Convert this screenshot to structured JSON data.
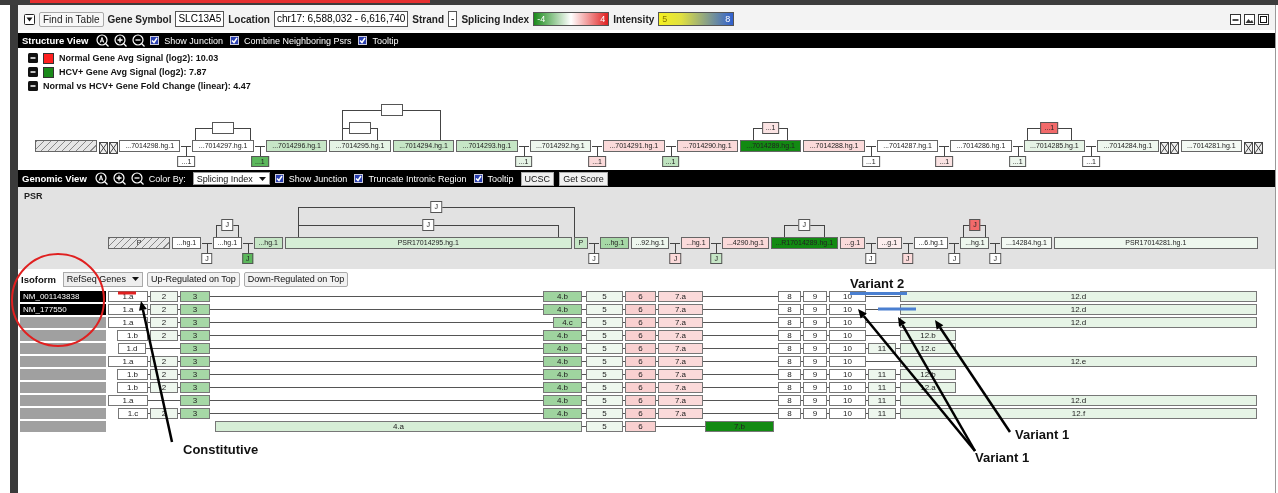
{
  "toolbar": {
    "find_button": "Find in Table",
    "fields": [
      {
        "label": "Gene Symbol",
        "value": "SLC13A5"
      },
      {
        "label": "Location",
        "value": "chr17: 6,588,032 - 6,616,740"
      },
      {
        "label": "Strand",
        "value": "-"
      }
    ],
    "scales": [
      {
        "label": "Splicing Index",
        "kind": "splicing",
        "min": "-4",
        "max": "4"
      },
      {
        "label": "Intensity",
        "kind": "intensity",
        "min": "5",
        "max": "8"
      }
    ]
  },
  "structure_view": {
    "title": "Structure View",
    "options": [
      {
        "label": "Show Junction",
        "checked": true
      },
      {
        "label": "Combine Neighboring Psrs",
        "checked": true
      },
      {
        "label": "Tooltip",
        "checked": true
      }
    ],
    "legend": [
      {
        "text": "Normal Gene Avg Signal (log2): 10.03",
        "color": "#ff2020"
      },
      {
        "text": "HCV+ Gene Avg Signal (log2): 7.87",
        "color": "#1a8a1a"
      },
      {
        "text": "Normal vs HCV+ Gene Fold Change (linear): 4.47"
      }
    ],
    "nodes": [
      {
        "kind": "hatch"
      },
      {
        "kind": "x"
      },
      {
        "kind": "x"
      },
      {
        "kind": "exon",
        "label": "...7014298.hg.1",
        "color": "#ffffff"
      },
      {
        "kind": "group",
        "arc": {
          "hatched": true
        },
        "children": [
          {
            "kind": "junction",
            "label": "...1",
            "color": "#ffffff"
          },
          {
            "kind": "exon",
            "label": "...7014297.hg.1",
            "color": "#ffffff"
          },
          {
            "kind": "junction",
            "label": "...1",
            "color": "#5cb85c"
          }
        ]
      },
      {
        "kind": "exon",
        "label": "...7014296.hg.1",
        "color": "#c6e6c6"
      },
      {
        "kind": "group",
        "arc": {
          "hatched": true
        },
        "children": [
          {
            "kind": "group",
            "arc": {
              "hatched": true
            },
            "children": [
              {
                "kind": "exon",
                "label": "...7014295.hg.1",
                "color": "#e6f4e6"
              }
            ]
          },
          {
            "kind": "exon",
            "label": "...7014294.hg.1",
            "color": "#c6e6c6"
          }
        ]
      },
      {
        "kind": "exon",
        "label": "...7014293.hg.1",
        "color": "#c6e6c6"
      },
      {
        "kind": "junction",
        "label": "...1",
        "color": "#e6f4e6"
      },
      {
        "kind": "exon",
        "label": "...7014292.hg.1",
        "color": "#eef7ee"
      },
      {
        "kind": "junction",
        "label": "...1",
        "color": "#fbdada"
      },
      {
        "kind": "exon",
        "label": "...7014291.hg.1",
        "color": "#fbdada"
      },
      {
        "kind": "junction",
        "label": "...1",
        "color": "#bfe3bf"
      },
      {
        "kind": "exon",
        "label": "...7014290.hg.1",
        "color": "#fbdada"
      },
      {
        "kind": "group",
        "arc": {
          "label": "...1",
          "color": "#fbe3e3"
        },
        "children": [
          {
            "kind": "exon",
            "label": "...7014289.hg.1",
            "color": "#128a12"
          }
        ]
      },
      {
        "kind": "exon",
        "label": "...7014288.hg.1",
        "color": "#fbdada"
      },
      {
        "kind": "junction",
        "label": "...1",
        "color": "#ffffff"
      },
      {
        "kind": "exon",
        "label": "...7014287.hg.1",
        "color": "#ffffff"
      },
      {
        "kind": "junction",
        "label": "...1",
        "color": "#fbe3e3"
      },
      {
        "kind": "exon",
        "label": "...7014286.hg.1",
        "color": "#ffffff"
      },
      {
        "kind": "group",
        "arc": {
          "label": "...1",
          "color": "#f26a6a"
        },
        "children": [
          {
            "kind": "junction",
            "label": "...1",
            "color": "#eef7ee"
          },
          {
            "kind": "exon",
            "label": "...7014285.hg.1",
            "color": "#e6f4e6"
          }
        ]
      },
      {
        "kind": "junction",
        "label": "...1",
        "color": "#ffffff"
      },
      {
        "kind": "exon",
        "label": "...7014284.hg.1",
        "color": "#eef7ee"
      },
      {
        "kind": "x"
      },
      {
        "kind": "x"
      },
      {
        "kind": "exon",
        "label": "...7014281.hg.1",
        "color": "#f4faf4"
      },
      {
        "kind": "x"
      },
      {
        "kind": "x"
      }
    ]
  },
  "genomic_view": {
    "title": "Genomic View",
    "color_by_label": "Color By:",
    "color_by": "Splicing Index",
    "options": [
      {
        "label": "Show Junction",
        "checked": true
      },
      {
        "label": "Truncate Intronic Region",
        "checked": true
      },
      {
        "label": "Tooltip",
        "checked": true
      }
    ],
    "buttons": [
      "UCSC",
      "Get Score"
    ],
    "track_label": "PSR",
    "nodes": [
      {
        "kind": "hatch",
        "label": "P"
      },
      {
        "kind": "exon",
        "label": "...hg.1",
        "color": "#ffffff"
      },
      {
        "kind": "group",
        "arc": {
          "label": "J",
          "hatched": true
        },
        "children": [
          {
            "kind": "junction",
            "label": "J",
            "color": "#ffffff"
          },
          {
            "kind": "exon",
            "label": "...hg.1",
            "color": "#ffffff"
          },
          {
            "kind": "junction",
            "label": "J",
            "color": "#5cb85c"
          }
        ]
      },
      {
        "kind": "exon",
        "label": "...hg.1",
        "color": "#c6e6c6"
      },
      {
        "kind": "group",
        "arc": {
          "label": "J",
          "hatched": true
        },
        "children": [
          {
            "kind": "group",
            "arc": {
              "label": "J",
              "hatched": true
            },
            "children": [
              {
                "kind": "exon",
                "label": "PSR17014295.hg.1",
                "color": "#d6eed6",
                "long": true
              }
            ]
          },
          {
            "kind": "exon",
            "label": "P",
            "color": "#c6e6c6"
          }
        ]
      },
      {
        "kind": "junction",
        "label": "J",
        "color": "#ffffff"
      },
      {
        "kind": "exon",
        "label": "...hg.1",
        "color": "#a6d8a6"
      },
      {
        "kind": "exon",
        "label": "...92.hg.1",
        "color": "#eef7ee"
      },
      {
        "kind": "junction",
        "label": "J",
        "color": "#fbdada"
      },
      {
        "kind": "exon",
        "label": "...hg.1",
        "color": "#fbdada"
      },
      {
        "kind": "junction",
        "label": "J",
        "color": "#c6e6c6"
      },
      {
        "kind": "exon",
        "label": "...4290.hg.1",
        "color": "#fbdada"
      },
      {
        "kind": "group",
        "arc": {
          "label": "J",
          "color": "#ffffff"
        },
        "children": [
          {
            "kind": "exon",
            "label": "...R17014289.hg.1",
            "color": "#128a12"
          }
        ]
      },
      {
        "kind": "exon",
        "label": "...g.1",
        "color": "#fbdada"
      },
      {
        "kind": "junction",
        "label": "J",
        "color": "#ffffff"
      },
      {
        "kind": "exon",
        "label": "...g.1",
        "color": "#fdeeee"
      },
      {
        "kind": "junction",
        "label": "J",
        "color": "#fbdada"
      },
      {
        "kind": "exon",
        "label": "...6.hg.1",
        "color": "#ffffff"
      },
      {
        "kind": "group",
        "arc": {
          "label": "J",
          "color": "#f26a6a"
        },
        "children": [
          {
            "kind": "junction",
            "label": "J",
            "color": "#ffffff"
          },
          {
            "kind": "exon",
            "label": "...hg.1",
            "color": "#eef7ee"
          },
          {
            "kind": "junction",
            "label": "J",
            "color": "#ffffff"
          }
        ]
      },
      {
        "kind": "exon",
        "label": "...14284.hg.1",
        "color": "#f4faf4"
      },
      {
        "kind": "exon",
        "label": "PSR17014281.hg.1",
        "color": "#eef7ee",
        "long": true
      }
    ]
  },
  "isoform": {
    "label": "Isoform",
    "source": "RefSeq Genes",
    "buttons": [
      "Up-Regulated on Top",
      "Down-Regulated on Top"
    ],
    "rows": [
      {
        "name": "NM_001143838",
        "exons": [
          {
            "label": "1.a",
            "kind": "firsta",
            "color": "#ffffff"
          },
          {
            "label": "2",
            "kind": "second",
            "color": "#eef7ee"
          },
          {
            "label": "3",
            "kind": "third",
            "color": "#a6d8a6"
          },
          {
            "label": "4.b",
            "kind": "fourthb",
            "color": "#9fd49f"
          },
          {
            "label": "5",
            "kind": "fifth",
            "color": "#eef7ee"
          },
          {
            "label": "6",
            "kind": "sixth",
            "color": "#f9d0d0"
          },
          {
            "label": "7.a",
            "kind": "seventha",
            "color": "#fbdada"
          },
          {
            "label": "8",
            "kind": "eighth",
            "color": "#ffffff"
          },
          {
            "label": "9",
            "kind": "ninth",
            "color": "#ffffff"
          },
          {
            "label": "10",
            "kind": "tenth",
            "color": "#ffffff"
          },
          {
            "label": "12.d",
            "kind": "lastlong",
            "color": "#e6f4e6"
          }
        ]
      },
      {
        "name": "NM_177550",
        "exons": [
          {
            "label": "1.a",
            "kind": "firsta",
            "color": "#ffffff"
          },
          {
            "label": "2",
            "kind": "second",
            "color": "#eef7ee"
          },
          {
            "label": "3",
            "kind": "third",
            "color": "#a6d8a6"
          },
          {
            "label": "4.b",
            "kind": "fourthb",
            "color": "#9fd49f"
          },
          {
            "label": "5",
            "kind": "fifth",
            "color": "#eef7ee"
          },
          {
            "label": "6",
            "kind": "sixth",
            "color": "#f9d0d0"
          },
          {
            "label": "7.a",
            "kind": "seventha",
            "color": "#fbdada"
          },
          {
            "label": "8",
            "kind": "eighth",
            "color": "#ffffff"
          },
          {
            "label": "9",
            "kind": "ninth",
            "color": "#ffffff"
          },
          {
            "label": "10",
            "kind": "tenth",
            "color": "#ffffff"
          },
          {
            "label": "12.d",
            "kind": "lastlong",
            "color": "#e6f4e6"
          }
        ]
      },
      {
        "exons": [
          {
            "label": "1.a",
            "kind": "firsta",
            "color": "#ffffff"
          },
          {
            "label": "2",
            "kind": "second",
            "color": "#eef7ee"
          },
          {
            "label": "3",
            "kind": "third",
            "color": "#a6d8a6"
          },
          {
            "label": "4.c",
            "kind": "fourthc",
            "color": "#a6d8a6"
          },
          {
            "label": "5",
            "kind": "fifth",
            "color": "#eef7ee"
          },
          {
            "label": "6",
            "kind": "sixth",
            "color": "#f9d0d0"
          },
          {
            "label": "7.a",
            "kind": "seventha",
            "color": "#fbdada"
          },
          {
            "label": "8",
            "kind": "eighth",
            "color": "#ffffff"
          },
          {
            "label": "9",
            "kind": "ninth",
            "color": "#ffffff"
          },
          {
            "label": "10",
            "kind": "tenth",
            "color": "#ffffff"
          },
          {
            "label": "12.d",
            "kind": "lastlong",
            "color": "#e6f4e6"
          }
        ]
      },
      {
        "exons": [
          {
            "label": "1.b",
            "kind": "firstb",
            "color": "#ffffff"
          },
          {
            "label": "2",
            "kind": "second",
            "color": "#eef7ee"
          },
          {
            "label": "3",
            "kind": "third",
            "color": "#a6d8a6"
          },
          {
            "label": "4.b",
            "kind": "fourthb",
            "color": "#9fd49f"
          },
          {
            "label": "5",
            "kind": "fifth",
            "color": "#eef7ee"
          },
          {
            "label": "6",
            "kind": "sixth",
            "color": "#f9d0d0"
          },
          {
            "label": "7.a",
            "kind": "seventha",
            "color": "#fbdada"
          },
          {
            "label": "8",
            "kind": "eighth",
            "color": "#ffffff"
          },
          {
            "label": "9",
            "kind": "ninth",
            "color": "#ffffff"
          },
          {
            "label": "10",
            "kind": "tenth",
            "color": "#ffffff"
          },
          {
            "label": "12.b",
            "kind": "lastshort",
            "color": "#e6f4e6"
          }
        ]
      },
      {
        "exons": [
          {
            "label": "1.d",
            "kind": "firstd",
            "color": "#ffffff"
          },
          {
            "label": "3",
            "kind": "third",
            "color": "#a6d8a6"
          },
          {
            "label": "4.b",
            "kind": "fourthb",
            "color": "#9fd49f"
          },
          {
            "label": "5",
            "kind": "fifth",
            "color": "#eef7ee"
          },
          {
            "label": "6",
            "kind": "sixth",
            "color": "#f9d0d0"
          },
          {
            "label": "7.a",
            "kind": "seventha",
            "color": "#fbdada"
          },
          {
            "label": "8",
            "kind": "eighth",
            "color": "#ffffff"
          },
          {
            "label": "9",
            "kind": "ninth",
            "color": "#ffffff"
          },
          {
            "label": "10",
            "kind": "tenth",
            "color": "#ffffff"
          },
          {
            "label": "11",
            "kind": "eleventh",
            "color": "#eef7ee"
          },
          {
            "label": "12.c",
            "kind": "lastshort",
            "color": "#e6f4e6"
          }
        ]
      },
      {
        "exons": [
          {
            "label": "1.a",
            "kind": "firsta",
            "color": "#ffffff"
          },
          {
            "label": "2",
            "kind": "second",
            "color": "#eef7ee"
          },
          {
            "label": "3",
            "kind": "third",
            "color": "#a6d8a6"
          },
          {
            "label": "4.b",
            "kind": "fourthb",
            "color": "#9fd49f"
          },
          {
            "label": "5",
            "kind": "fifth",
            "color": "#eef7ee"
          },
          {
            "label": "6",
            "kind": "sixth",
            "color": "#f9d0d0"
          },
          {
            "label": "7.a",
            "kind": "seventha",
            "color": "#fbdada"
          },
          {
            "label": "8",
            "kind": "eighth",
            "color": "#ffffff"
          },
          {
            "label": "9",
            "kind": "ninth",
            "color": "#ffffff"
          },
          {
            "label": "10",
            "kind": "tenth",
            "color": "#ffffff"
          },
          {
            "label": "12.e",
            "kind": "lastlong",
            "color": "#e6f4e6"
          }
        ]
      },
      {
        "exons": [
          {
            "label": "1.b",
            "kind": "firstb",
            "color": "#ffffff"
          },
          {
            "label": "2",
            "kind": "second",
            "color": "#eef7ee"
          },
          {
            "label": "3",
            "kind": "third",
            "color": "#a6d8a6"
          },
          {
            "label": "4.b",
            "kind": "fourthb",
            "color": "#9fd49f"
          },
          {
            "label": "5",
            "kind": "fifth",
            "color": "#eef7ee"
          },
          {
            "label": "6",
            "kind": "sixth",
            "color": "#f9d0d0"
          },
          {
            "label": "7.a",
            "kind": "seventha",
            "color": "#fbdada"
          },
          {
            "label": "8",
            "kind": "eighth",
            "color": "#ffffff"
          },
          {
            "label": "9",
            "kind": "ninth",
            "color": "#ffffff"
          },
          {
            "label": "10",
            "kind": "tenth",
            "color": "#ffffff"
          },
          {
            "label": "11",
            "kind": "eleventh",
            "color": "#eef7ee"
          },
          {
            "label": "12.b",
            "kind": "lastshort",
            "color": "#e6f4e6"
          }
        ]
      },
      {
        "exons": [
          {
            "label": "1.b",
            "kind": "firstb",
            "color": "#ffffff"
          },
          {
            "label": "2",
            "kind": "second",
            "color": "#eef7ee"
          },
          {
            "label": "3",
            "kind": "third",
            "color": "#a6d8a6"
          },
          {
            "label": "4.b",
            "kind": "fourthb",
            "color": "#9fd49f"
          },
          {
            "label": "5",
            "kind": "fifth",
            "color": "#eef7ee"
          },
          {
            "label": "6",
            "kind": "sixth",
            "color": "#f9d0d0"
          },
          {
            "label": "7.a",
            "kind": "seventha",
            "color": "#fbdada"
          },
          {
            "label": "8",
            "kind": "eighth",
            "color": "#ffffff"
          },
          {
            "label": "9",
            "kind": "ninth",
            "color": "#ffffff"
          },
          {
            "label": "10",
            "kind": "tenth",
            "color": "#ffffff"
          },
          {
            "label": "11",
            "kind": "eleventh",
            "color": "#eef7ee"
          },
          {
            "label": "12.a",
            "kind": "lastshort",
            "color": "#e6f4e6"
          }
        ]
      },
      {
        "exons": [
          {
            "label": "1.a",
            "kind": "firsta",
            "color": "#ffffff"
          },
          {
            "label": "3",
            "kind": "third",
            "color": "#a6d8a6"
          },
          {
            "label": "4.b",
            "kind": "fourthb",
            "color": "#9fd49f"
          },
          {
            "label": "5",
            "kind": "fifth",
            "color": "#eef7ee"
          },
          {
            "label": "6",
            "kind": "sixth",
            "color": "#f9d0d0"
          },
          {
            "label": "7.a",
            "kind": "seventha",
            "color": "#fbdada"
          },
          {
            "label": "8",
            "kind": "eighth",
            "color": "#ffffff"
          },
          {
            "label": "9",
            "kind": "ninth",
            "color": "#ffffff"
          },
          {
            "label": "10",
            "kind": "tenth",
            "color": "#ffffff"
          },
          {
            "label": "11",
            "kind": "eleventh",
            "color": "#eef7ee"
          },
          {
            "label": "12.d",
            "kind": "lastlong",
            "color": "#e6f4e6"
          }
        ]
      },
      {
        "exons": [
          {
            "label": "1.c",
            "kind": "firstc",
            "color": "#ffffff"
          },
          {
            "label": "2",
            "kind": "second",
            "color": "#eef7ee"
          },
          {
            "label": "3",
            "kind": "third",
            "color": "#a6d8a6"
          },
          {
            "label": "4.b",
            "kind": "fourthb",
            "color": "#9fd49f"
          },
          {
            "label": "5",
            "kind": "fifth",
            "color": "#eef7ee"
          },
          {
            "label": "6",
            "kind": "sixth",
            "color": "#f9d0d0"
          },
          {
            "label": "7.a",
            "kind": "seventha",
            "color": "#fbdada"
          },
          {
            "label": "8",
            "kind": "eighth",
            "color": "#ffffff"
          },
          {
            "label": "9",
            "kind": "ninth",
            "color": "#ffffff"
          },
          {
            "label": "10",
            "kind": "tenth",
            "color": "#ffffff"
          },
          {
            "label": "11",
            "kind": "eleventh",
            "color": "#eef7ee"
          },
          {
            "label": "12.f",
            "kind": "lastlong",
            "color": "#e6f4e6"
          }
        ]
      },
      {
        "exons": [
          {
            "label": "4.a",
            "kind": "fourtha",
            "color": "#d6eed6"
          },
          {
            "label": "5",
            "kind": "fifth",
            "color": "#eef7ee"
          },
          {
            "label": "6",
            "kind": "sixth",
            "color": "#f9d0d0"
          },
          {
            "label": "7.b",
            "kind": "seventhb",
            "color": "#128a12"
          }
        ]
      }
    ]
  },
  "annotations": [
    {
      "text": "Variant 2"
    },
    {
      "text": "Variant 1"
    },
    {
      "text": "Variant 1"
    },
    {
      "text": "Constitutive"
    }
  ]
}
